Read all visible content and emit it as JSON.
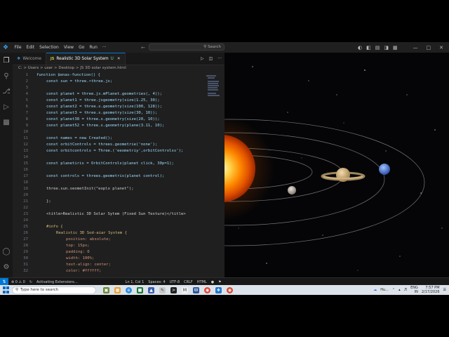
{
  "menu": {
    "items": [
      "File",
      "Edit",
      "Selection",
      "View",
      "Go",
      "Run",
      "···"
    ],
    "search_placeholder": "Search"
  },
  "tabs": [
    {
      "label": "Welcome",
      "active": false
    },
    {
      "label": "Realistic 3D Solar System",
      "suffix": "U",
      "active": true
    }
  ],
  "breadcrumb": "C: > Users > user > Desktop > JS 3D solar system.html",
  "code_lines": [
    {
      "n": "1",
      "t": "function $enas-function() {",
      "indent": 0
    },
    {
      "n": "2",
      "t": "const sun = three.•three.js;",
      "indent": 1
    },
    {
      "n": "3",
      "t": "",
      "indent": 0
    },
    {
      "n": "4",
      "t": "const planet = three.js.mPlanet.geometries(, 4));",
      "indent": 1
    },
    {
      "n": "5",
      "t": "const planet1 = three.jsgeometry(size(1.25, 30);",
      "indent": 1
    },
    {
      "n": "6",
      "t": "const planet2 = three.s.geometry(size(100, 128));",
      "indent": 1
    },
    {
      "n": "7",
      "t": "const planet3 = three.s.geometry(size(30, 10));",
      "indent": 1
    },
    {
      "n": "8",
      "t": "const planet38 = three.s.geometry(size(20, 10));",
      "indent": 1
    },
    {
      "n": "9",
      "t": "const planet52 = three.s.geometry(plane(3.11, 10);",
      "indent": 1
    },
    {
      "n": "10",
      "t": "",
      "indent": 0
    },
    {
      "n": "11",
      "t": "const names = new Created();",
      "indent": 1
    },
    {
      "n": "12",
      "t": "const orbitControls = threes.geometrie('none');",
      "indent": 1
    },
    {
      "n": "13",
      "t": "const orbitcontrols = Three.('eeometriy',orbitControlss');",
      "indent": 1
    },
    {
      "n": "14",
      "t": "",
      "indent": 0
    },
    {
      "n": "15",
      "t": "const planetiris = OrbitControls(planet click, 30p=1);",
      "indent": 1
    },
    {
      "n": "16",
      "t": "",
      "indent": 0
    },
    {
      "n": "17",
      "t": "const controls = threes.geometris(planet control);",
      "indent": 1
    },
    {
      "n": "18",
      "t": "",
      "indent": 0
    },
    {
      "n": "19",
      "t": "three.sun.seometInit(\"eoplo planet\");",
      "indent": 1
    },
    {
      "n": "20",
      "t": "",
      "indent": 0
    },
    {
      "n": "21",
      "t": "};",
      "indent": 1
    },
    {
      "n": "22",
      "t": "",
      "indent": 0
    },
    {
      "n": "23",
      "t": "<title>Realistic 3D Solar Sytem (Fixed Sun Texture)</title>",
      "indent": 1
    },
    {
      "n": "24",
      "t": "",
      "indent": 0
    },
    {
      "n": "25",
      "t": "#info {",
      "indent": 1
    },
    {
      "n": "26",
      "t": "Realistic 3D Sod-aiar System {",
      "indent": 2
    },
    {
      "n": "27",
      "t": "position: absolute;",
      "indent": 3
    },
    {
      "n": "28",
      "t": "top: 15px;",
      "indent": 3
    },
    {
      "n": "29",
      "t": "padding: 0",
      "indent": 3
    },
    {
      "n": "30",
      "t": "width: 100%;",
      "indent": 3
    },
    {
      "n": "31",
      "t": "text-align: center;",
      "indent": 3
    },
    {
      "n": "32",
      "t": "color: #ffffff;",
      "indent": 3
    }
  ],
  "statusbar": {
    "errors": "⊗ 0 ⚠ 0",
    "activity": "Activating Extensions...",
    "position": "Ln 1, Col 1",
    "spaces": "Spaces: 4",
    "encoding": "UTF-8",
    "eol": "CRLF",
    "language": "HTML"
  },
  "taskbar": {
    "search_placeholder": "Type here to search",
    "weather": "Hu...",
    "lang": "ENG",
    "region": "IN",
    "time": "7:57 PM",
    "date": "2/17/2026"
  },
  "colors": {
    "accent": "#0078d4",
    "sun": "#ff8a00",
    "saturn": "#d8b47a",
    "neptune": "#4a7fd8"
  }
}
